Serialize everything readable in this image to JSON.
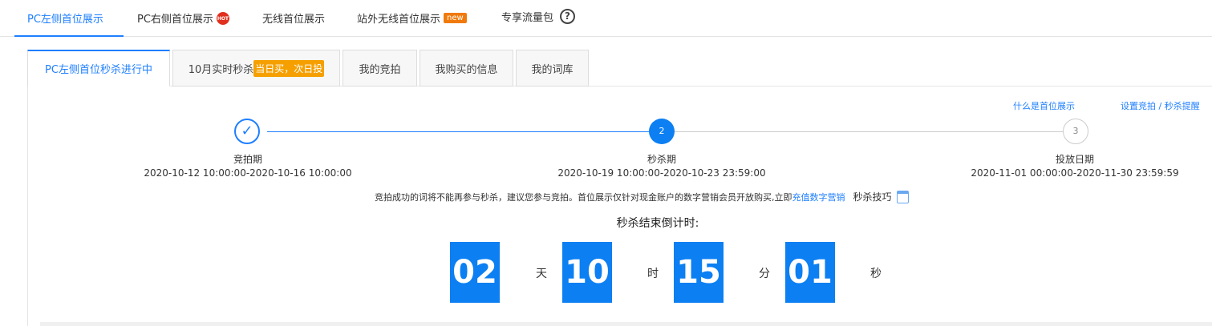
{
  "top_tabs": [
    {
      "label": "PC左侧首位展示",
      "active": true
    },
    {
      "label": "PC右侧首位展示",
      "badge": "HOT"
    },
    {
      "label": "无线首位展示"
    },
    {
      "label": "站外无线首位展示",
      "badge": "new"
    },
    {
      "label": "专享流量包",
      "icon": "help-icon"
    }
  ],
  "sub_tabs": [
    {
      "label": "PC左侧首位秒杀进行中",
      "active": true
    },
    {
      "label": "10月实时秒杀",
      "badge": "当日买，次日投"
    },
    {
      "label": "我的竞拍"
    },
    {
      "label": "我购买的信息"
    },
    {
      "label": "我的词库"
    }
  ],
  "links": {
    "what": "什么是首位展示",
    "remind": "设置竞拍 / 秒杀提醒"
  },
  "steps": [
    {
      "num": "1",
      "title": "竞拍期",
      "dates": "2020-10-12 10:00:00-2020-10-16 10:00:00",
      "status": "done"
    },
    {
      "num": "2",
      "title": "秒杀期",
      "dates": "2020-10-19 10:00:00-2020-10-23 23:59:00",
      "status": "current"
    },
    {
      "num": "3",
      "title": "投放日期",
      "dates": "2020-11-01 00:00:00-2020-11-30 23:59:59",
      "status": "pending"
    }
  ],
  "notice": {
    "text": "竞拍成功的词将不能再参与秒杀，建议您参与竞拍。首位展示仅针对现金账户的数字营销会员开放购买,立即",
    "link": "充值数字营销",
    "tips": "秒杀技巧"
  },
  "countdown": {
    "title": "秒杀结束倒计时:",
    "days": "02",
    "days_unit": "天",
    "hours": "10",
    "hours_unit": "时",
    "minutes": "15",
    "minutes_unit": "分",
    "seconds": "01",
    "seconds_unit": "秒"
  },
  "colors": {
    "accent": "#1f7fff",
    "countdown_bg": "#0c7ff2",
    "badge": "#f5a000"
  }
}
